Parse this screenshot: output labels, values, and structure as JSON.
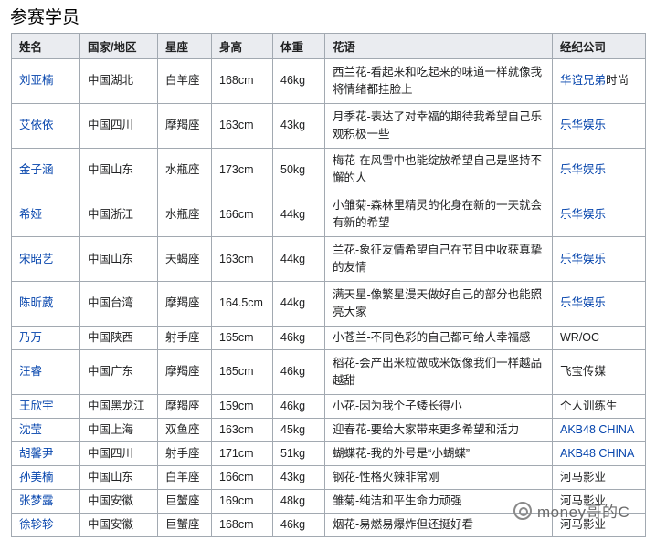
{
  "heading": "参赛学员",
  "columns": [
    "姓名",
    "国家/地区",
    "星座",
    "身高",
    "体重",
    "花语",
    "经纪公司"
  ],
  "rows": [
    {
      "name": "刘亚楠",
      "region": "中国湖北",
      "sign": "白羊座",
      "height": "168cm",
      "weight": "46kg",
      "flower": "西兰花-看起来和吃起来的味道一样就像我将情绪都挂脸上",
      "company_link": "华谊兄弟",
      "company_text": "时尚"
    },
    {
      "name": "艾依依",
      "region": "中国四川",
      "sign": "摩羯座",
      "height": "163cm",
      "weight": "43kg",
      "flower": "月季花-表达了对幸福的期待我希望自己乐观积极一些",
      "company_link": "乐华娱乐",
      "company_text": ""
    },
    {
      "name": "金子涵",
      "region": "中国山东",
      "sign": "水瓶座",
      "height": "173cm",
      "weight": "50kg",
      "flower": "梅花-在风雪中也能绽放希望自己是坚持不懈的人",
      "company_link": "乐华娱乐",
      "company_text": ""
    },
    {
      "name": "希娅",
      "region": "中国浙江",
      "sign": "水瓶座",
      "height": "166cm",
      "weight": "44kg",
      "flower": "小雏菊-森林里精灵的化身在新的一天就会有新的希望",
      "company_link": "乐华娱乐",
      "company_text": ""
    },
    {
      "name": "宋昭艺",
      "region": "中国山东",
      "sign": "天蝎座",
      "height": "163cm",
      "weight": "44kg",
      "flower": "兰花-象征友情希望自己在节目中收获真挚的友情",
      "company_link": "乐华娱乐",
      "company_text": ""
    },
    {
      "name": "陈昕葳",
      "region": "中国台湾",
      "sign": "摩羯座",
      "height": "164.5cm",
      "weight": "44kg",
      "flower": "满天星-像繁星漫天做好自己的部分也能照亮大家",
      "company_link": "乐华娱乐",
      "company_text": ""
    },
    {
      "name": "乃万",
      "region": "中国陕西",
      "sign": "射手座",
      "height": "165cm",
      "weight": "46kg",
      "flower": "小苍兰-不同色彩的自己都可给人幸福感",
      "company_link": "",
      "company_text": "WR/OC"
    },
    {
      "name": "汪睿",
      "region": "中国广东",
      "sign": "摩羯座",
      "height": "165cm",
      "weight": "46kg",
      "flower": "稻花-会产出米粒做成米饭像我们一样越品越甜",
      "company_link": "",
      "company_text": "飞宝传媒"
    },
    {
      "name": "王欣宇",
      "region": "中国黑龙江",
      "sign": "摩羯座",
      "height": "159cm",
      "weight": "46kg",
      "flower": "小花-因为我个子矮长得小",
      "company_link": "",
      "company_text": "个人训练生"
    },
    {
      "name": "沈莹",
      "region": "中国上海",
      "sign": "双鱼座",
      "height": "163cm",
      "weight": "45kg",
      "flower": "迎春花-要给大家带来更多希望和活力",
      "company_link": "AKB48 CHINA",
      "company_text": ""
    },
    {
      "name": "胡馨尹",
      "region": "中国四川",
      "sign": "射手座",
      "height": "171cm",
      "weight": "51kg",
      "flower": "蝴蝶花-我的外号是“小蝴蝶”",
      "company_link": "AKB48 CHINA",
      "company_text": ""
    },
    {
      "name": "孙美楠",
      "region": "中国山东",
      "sign": "白羊座",
      "height": "166cm",
      "weight": "43kg",
      "flower": "钢花-性格火辣非常刚",
      "company_link": "",
      "company_text": "河马影业"
    },
    {
      "name": "张梦露",
      "region": "中国安徽",
      "sign": "巨蟹座",
      "height": "169cm",
      "weight": "48kg",
      "flower": "雏菊-纯洁和平生命力顽强",
      "company_link": "",
      "company_text": "河马影业"
    },
    {
      "name": "徐轸轸",
      "region": "中国安徽",
      "sign": "巨蟹座",
      "height": "168cm",
      "weight": "46kg",
      "flower": "烟花-易燃易爆炸但还挺好看",
      "company_link": "",
      "company_text": "河马影业"
    }
  ],
  "watermark": "money哥的C"
}
